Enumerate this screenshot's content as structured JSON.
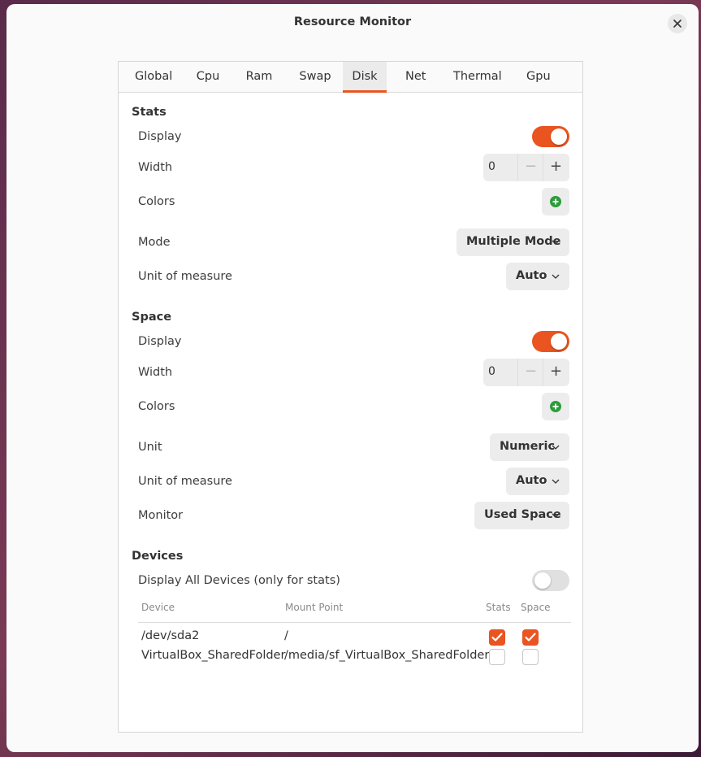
{
  "window": {
    "title": "Resource Monitor"
  },
  "tabs": [
    "Global",
    "Cpu",
    "Ram",
    "Swap",
    "Disk",
    "Net",
    "Thermal",
    "Gpu"
  ],
  "active_tab": "Disk",
  "stats": {
    "title": "Stats",
    "display_label": "Display",
    "display_on": true,
    "width_label": "Width",
    "width_value": "0",
    "colors_label": "Colors",
    "mode_label": "Mode",
    "mode_value": "Multiple Mode",
    "unit_measure_label": "Unit of measure",
    "unit_measure_value": "Auto"
  },
  "space": {
    "title": "Space",
    "display_label": "Display",
    "display_on": true,
    "width_label": "Width",
    "width_value": "0",
    "colors_label": "Colors",
    "unit_label": "Unit",
    "unit_value": "Numeric",
    "unit_measure_label": "Unit of measure",
    "unit_measure_value": "Auto",
    "monitor_label": "Monitor",
    "monitor_value": "Used Space"
  },
  "devices": {
    "title": "Devices",
    "display_all_label": "Display All Devices (only for stats)",
    "display_all_on": false,
    "columns": [
      "Device",
      "Mount Point",
      "Stats",
      "Space"
    ],
    "rows": [
      {
        "device": "/dev/sda2",
        "mount": "/",
        "stats": true,
        "space": true
      },
      {
        "device": "VirtualBox_SharedFolder",
        "mount": "/media/sf_VirtualBox_SharedFolder",
        "stats": false,
        "space": false
      }
    ]
  },
  "colors": {
    "accent": "#e95420",
    "add_green": "#2a9d3a"
  },
  "icons": {
    "close": "close-icon",
    "add": "add-color-icon",
    "chevron": "chevron-down-icon",
    "check": "check-icon"
  }
}
